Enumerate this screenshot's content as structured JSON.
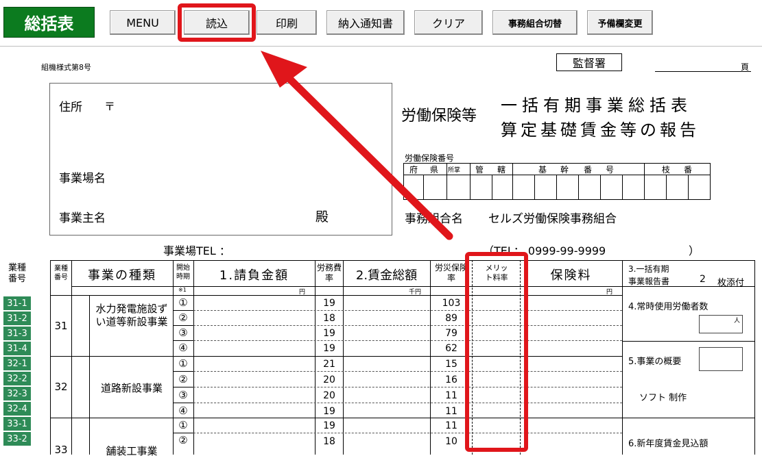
{
  "toolbar": {
    "title": "総括表",
    "buttons": [
      "MENU",
      "読込",
      "印刷",
      "納入通知書",
      "クリア",
      "事務組合切替",
      "予備欄変更"
    ]
  },
  "header": {
    "form_no": "組機様式第8号",
    "kantoku": "監督署",
    "page_label": "頁",
    "address_label": "住所",
    "postal_mark": "〒",
    "site_name_label": "事業場名",
    "owner_label": "事業主名",
    "dono": "殿",
    "tel_label": "事業場TEL ：",
    "tel_union": "（TEL：  0999-99-9999",
    "tel_close": "）",
    "title_left": "労働保険等",
    "title_line1": "一括有期事業総括表",
    "title_line2": "算定基礎賃金等の報告",
    "insurance_no_label": "労働保険番号",
    "insurance_cols": [
      "府",
      "県",
      "所掌",
      "管",
      "轄",
      "基",
      "幹",
      "番",
      "号",
      "枝",
      "番"
    ],
    "union_label": "事務組合名",
    "union_name": "セルズ労働保険事務組合"
  },
  "table": {
    "head": {
      "gyoshu_bango": "業種番号",
      "jigyo_type": "事業の種類",
      "kaishi": "開始時期",
      "ukeoi": "1.請負金額",
      "romu": "労務費率",
      "chingin": "2.賃金総額",
      "rosai": "労災保険率",
      "merit": "メリット料率",
      "hoken": "保険料",
      "note3a": "3.一括有期",
      "note3b": "事業報告書",
      "note3c": "2",
      "note3d": "枚添付",
      "sub1": "※1",
      "yen": "円",
      "senyen": "千円",
      "yen2": "円"
    },
    "side_label": "業種番号",
    "side_tags": [
      "31-1",
      "31-2",
      "31-3",
      "31-4",
      "32-1",
      "32-2",
      "32-3",
      "32-4",
      "33-1",
      "33-2"
    ],
    "groups": [
      {
        "no": "31",
        "name": "水力発電施設ずい道等新設事業",
        "romu": [
          "19",
          "18",
          "19",
          "19"
        ],
        "rosai": [
          "103",
          "89",
          "79",
          "62"
        ]
      },
      {
        "no": "32",
        "name": "道路新設事業",
        "romu": [
          "21",
          "20",
          "20",
          "19"
        ],
        "rosai": [
          "15",
          "16",
          "11",
          "11"
        ]
      },
      {
        "no": "33",
        "name": "舗装工事業",
        "romu": [
          "19",
          "18"
        ],
        "rosai": [
          "11",
          "10"
        ]
      }
    ],
    "periods": [
      "①",
      "②",
      "③",
      "④"
    ],
    "right_notes": {
      "n4": "4.常時使用労働者数",
      "n4_unit": "人",
      "n5": "5.事業の概要",
      "n5_value": "ソフト 制作",
      "n6": "6.新年度賃金見込額"
    }
  },
  "colors": {
    "title_green": "#0c7b1f",
    "tag_green": "#2e8b57",
    "highlight_red": "#e0161b"
  }
}
